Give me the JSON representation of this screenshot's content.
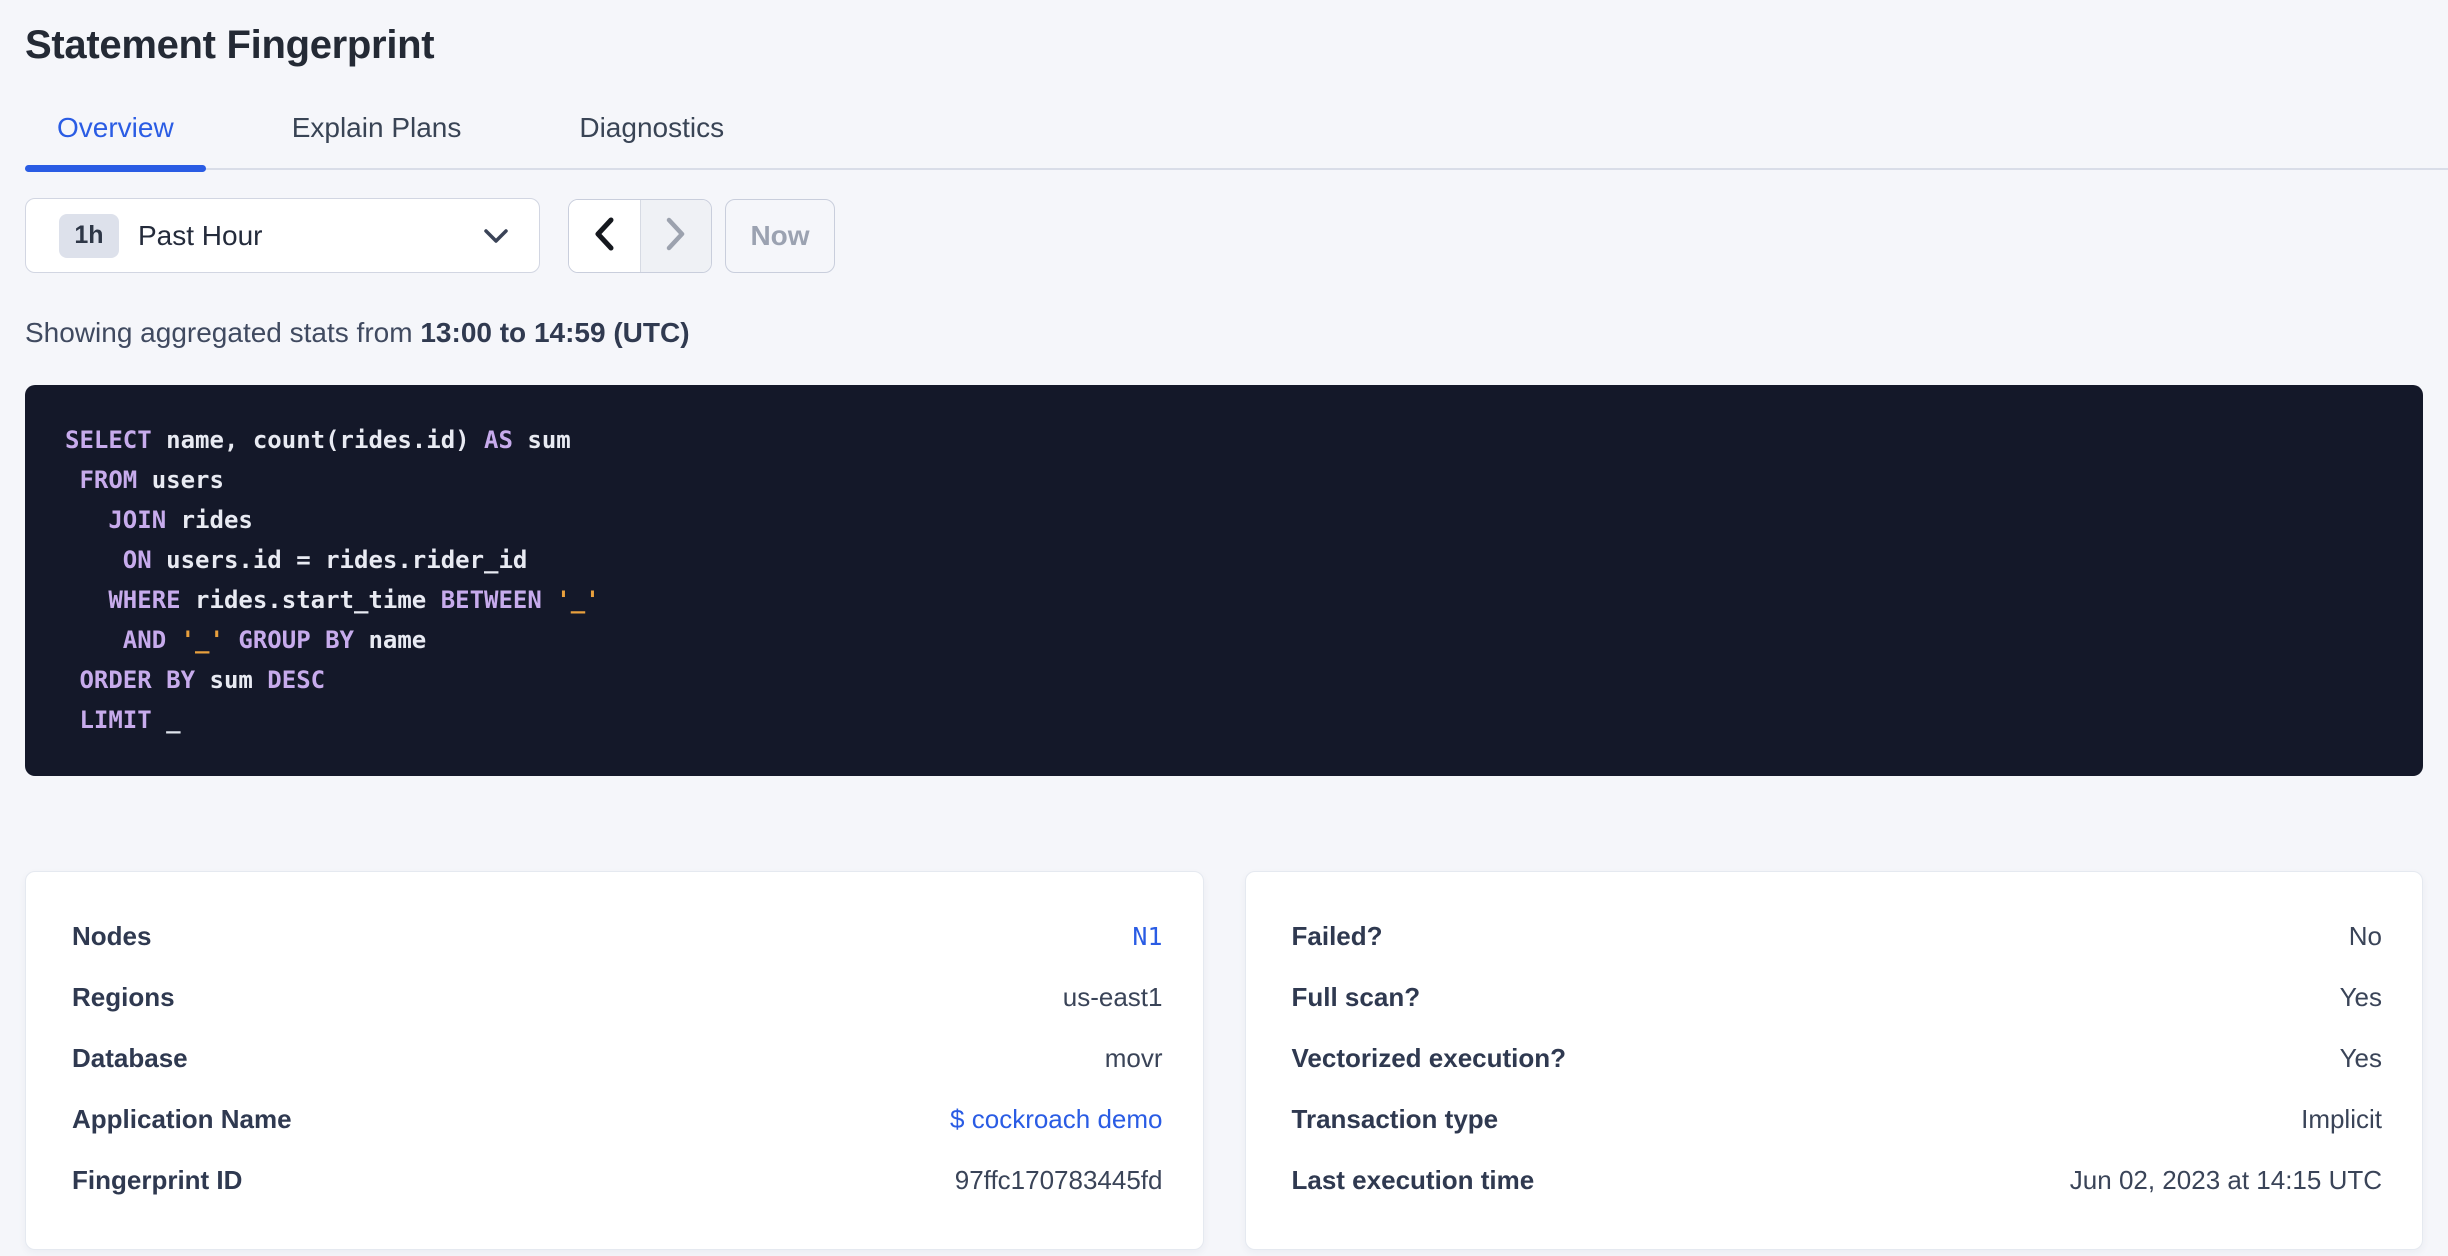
{
  "page": {
    "title": "Statement Fingerprint"
  },
  "tabs": [
    {
      "label": "Overview",
      "active": true
    },
    {
      "label": "Explain Plans",
      "active": false
    },
    {
      "label": "Diagnostics",
      "active": false
    }
  ],
  "time_controls": {
    "range_badge": "1h",
    "range_label": "Past Hour",
    "prev_enabled": true,
    "next_enabled": false,
    "now_label": "Now"
  },
  "stats_line": {
    "prefix": "Showing aggregated stats from ",
    "range_bold": "13:00 to 14:59 (UTC)"
  },
  "sql": {
    "lines": [
      [
        {
          "t": "kw",
          "v": "SELECT"
        },
        {
          "t": "pl",
          "v": " name, count(rides.id) "
        },
        {
          "t": "kw",
          "v": "AS"
        },
        {
          "t": "pl",
          "v": " sum"
        }
      ],
      [
        {
          "t": "kw",
          "v": " FROM"
        },
        {
          "t": "pl",
          "v": " users"
        }
      ],
      [
        {
          "t": "kw",
          "v": "   JOIN"
        },
        {
          "t": "pl",
          "v": " rides"
        }
      ],
      [
        {
          "t": "kw",
          "v": "    ON"
        },
        {
          "t": "pl",
          "v": " users.id = rides.rider_id"
        }
      ],
      [
        {
          "t": "kw",
          "v": "   WHERE"
        },
        {
          "t": "pl",
          "v": " rides.start_time "
        },
        {
          "t": "kw",
          "v": "BETWEEN"
        },
        {
          "t": "str",
          "v": " '_'"
        }
      ],
      [
        {
          "t": "kw",
          "v": "    AND"
        },
        {
          "t": "str",
          "v": " '_' "
        },
        {
          "t": "kw",
          "v": "GROUP BY"
        },
        {
          "t": "pl",
          "v": " name"
        }
      ],
      [
        {
          "t": "kw",
          "v": " ORDER BY"
        },
        {
          "t": "pl",
          "v": " sum "
        },
        {
          "t": "kw",
          "v": "DESC"
        }
      ],
      [
        {
          "t": "kw",
          "v": " LIMIT"
        },
        {
          "t": "num",
          "v": " _"
        }
      ]
    ]
  },
  "cards": {
    "left": {
      "rows": [
        {
          "label": "Nodes",
          "value": "N1",
          "kind": "link-mono"
        },
        {
          "label": "Regions",
          "value": "us-east1",
          "kind": "plain"
        },
        {
          "label": "Database",
          "value": "movr",
          "kind": "plain"
        },
        {
          "label": "Application Name",
          "value": "$ cockroach demo",
          "kind": "link"
        },
        {
          "label": "Fingerprint ID",
          "value": "97ffc170783445fd",
          "kind": "plain"
        }
      ]
    },
    "right": {
      "rows": [
        {
          "label": "Failed?",
          "value": "No",
          "kind": "plain"
        },
        {
          "label": "Full scan?",
          "value": "Yes",
          "kind": "plain"
        },
        {
          "label": "Vectorized execution?",
          "value": "Yes",
          "kind": "plain"
        },
        {
          "label": "Transaction type",
          "value": "Implicit",
          "kind": "plain"
        },
        {
          "label": "Last execution time",
          "value": "Jun 02, 2023 at 14:15 UTC",
          "kind": "plain"
        }
      ]
    }
  },
  "icons": {
    "select_caret": "chevron-down-icon",
    "prev": "chevron-left-icon",
    "next": "chevron-right-icon"
  },
  "colors": {
    "page_bg": "#f5f6fa",
    "accent_blue": "#2a5ce4",
    "heading": "#242a35",
    "body_text": "#394455",
    "divider": "#d9dde8",
    "code_bg": "#141829",
    "code_keyword": "#c7abec",
    "code_plain": "#e8eaf2",
    "code_string": "#e9a03d",
    "card_bg": "#ffffff"
  }
}
